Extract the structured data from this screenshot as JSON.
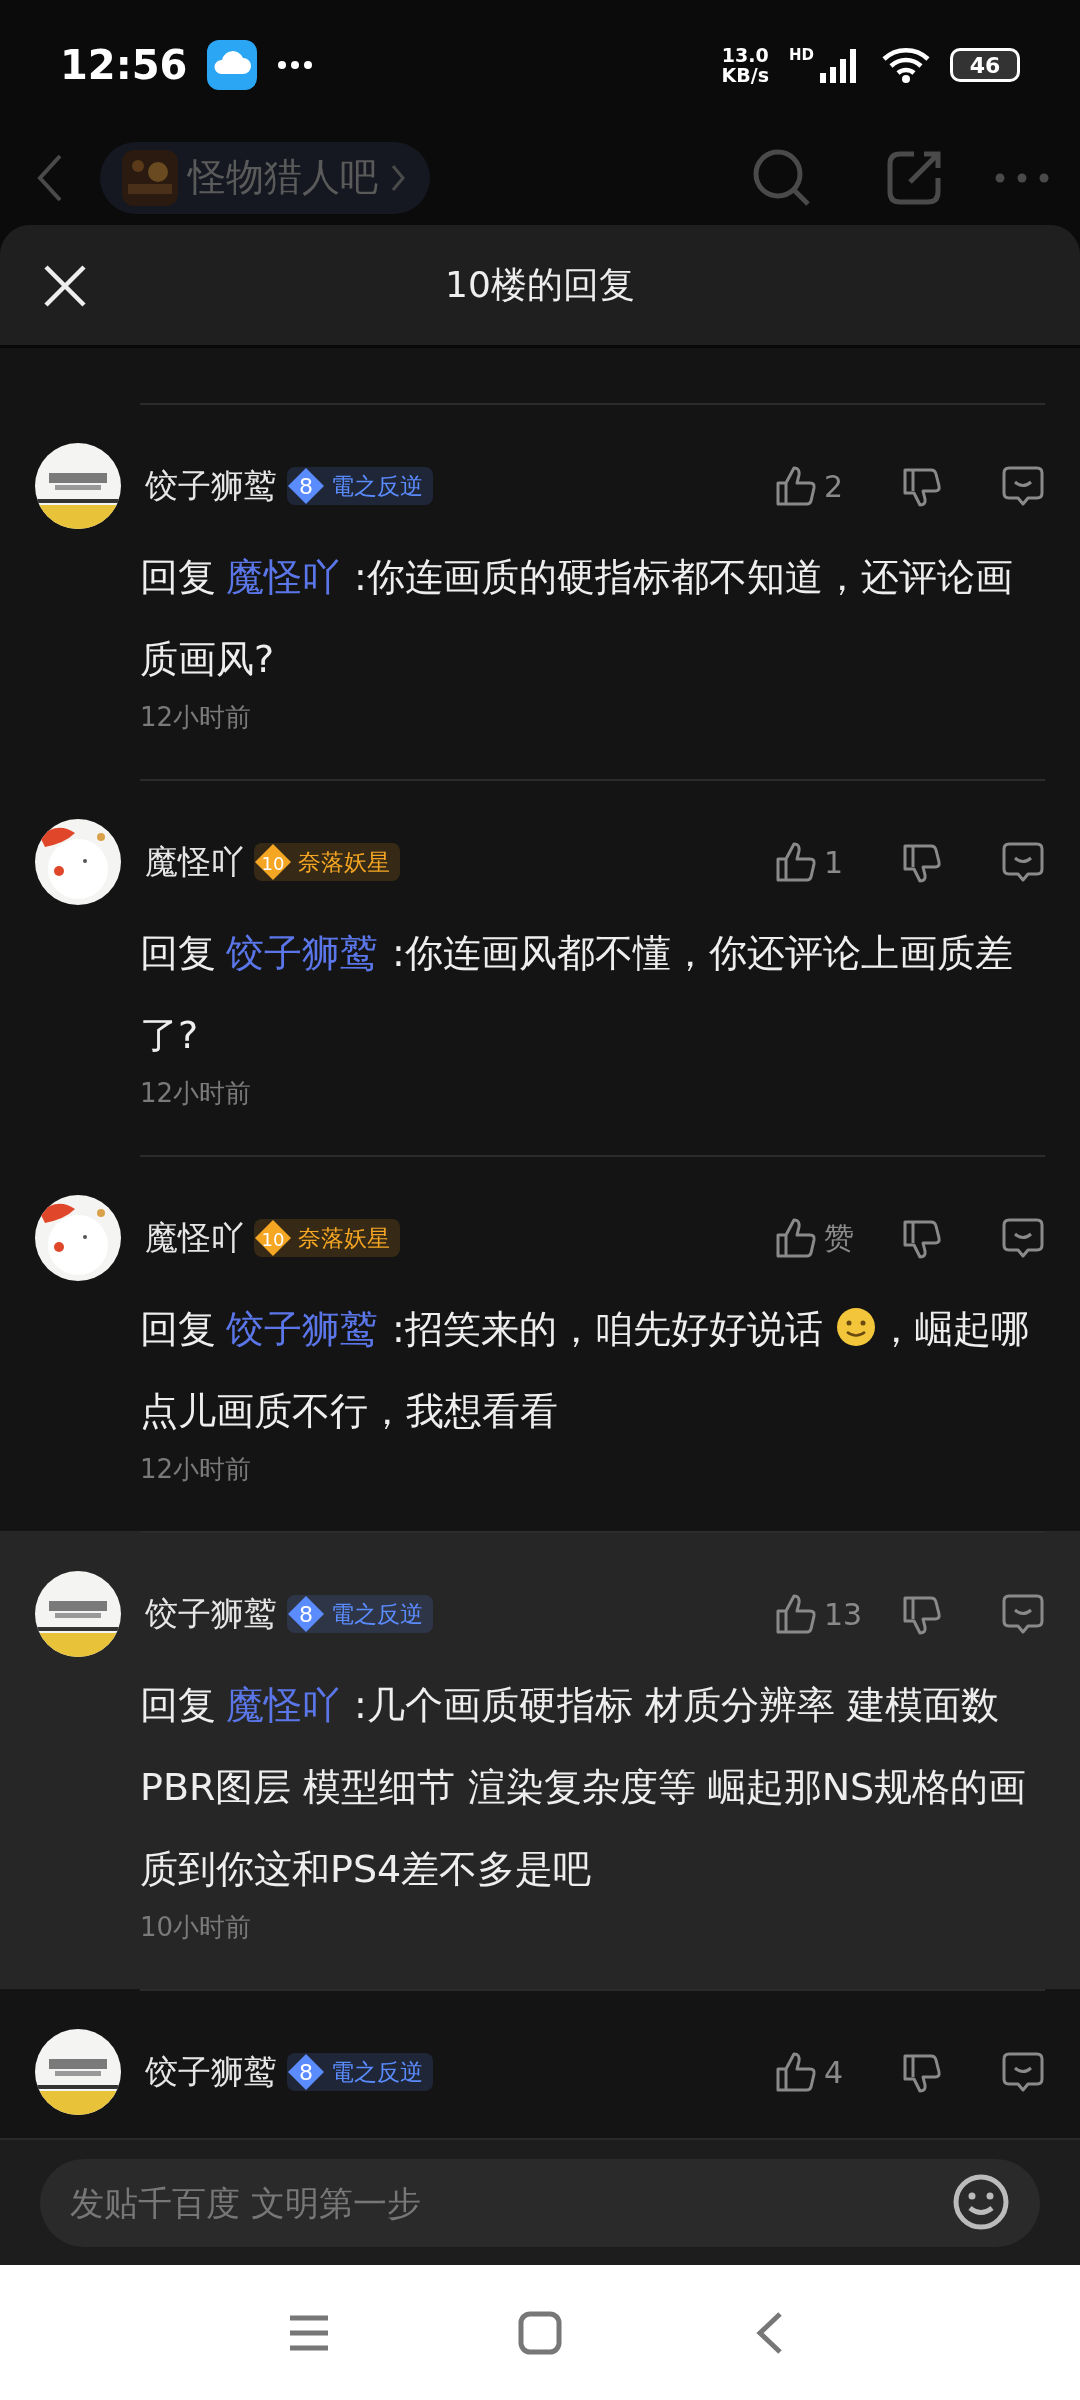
{
  "status_bar": {
    "time": "12:56",
    "net_speed": "13.0",
    "net_unit": "KB/s",
    "network_type": "HD",
    "battery": "46"
  },
  "forum_header": {
    "forum_name": "怪物猎人吧"
  },
  "sheet": {
    "title": "10楼的回复"
  },
  "comments": [
    {
      "user": "饺子狮鹫",
      "level": "8",
      "badge": {
        "title": "電之反逆",
        "color": "#5b8cff"
      },
      "likes": "2",
      "reply_prefix": "回复",
      "reply_to": "魔怪吖",
      "segments": [
        {
          "kind": "text",
          "text": ":你连画质的硬指标都不知道，还评论画质画风?"
        }
      ],
      "time": "12小时前",
      "highlighted": false
    },
    {
      "user": "魔怪吖",
      "level": "10",
      "badge": {
        "title": "奈落妖星",
        "color": "#f5a623"
      },
      "likes": "1",
      "reply_prefix": "回复",
      "reply_to": "饺子狮鹫",
      "segments": [
        {
          "kind": "text",
          "text": ":你连画风都不懂，你还评论上画质差了?"
        }
      ],
      "time": "12小时前",
      "highlighted": false
    },
    {
      "user": "魔怪吖",
      "level": "10",
      "badge": {
        "title": "奈落妖星",
        "color": "#f5a623"
      },
      "likes": "赞",
      "reply_prefix": "回复",
      "reply_to": "饺子狮鹫",
      "segments": [
        {
          "kind": "text",
          "text": ":招笑来的，咱先好好说话 "
        },
        {
          "kind": "emoji"
        },
        {
          "kind": "text",
          "text": "，崛起哪点儿画质不行，我想看看"
        }
      ],
      "time": "12小时前",
      "highlighted": false
    },
    {
      "user": "饺子狮鹫",
      "level": "8",
      "badge": {
        "title": "電之反逆",
        "color": "#5b8cff"
      },
      "likes": "13",
      "reply_prefix": "回复",
      "reply_to": "魔怪吖",
      "segments": [
        {
          "kind": "text",
          "text": ":几个画质硬指标 材质分辨率 建模面数 PBR图层 模型细节 渲染复杂度等 崛起那NS规格的画质到你这和PS4差不多是吧"
        }
      ],
      "time": "10小时前",
      "highlighted": true
    },
    {
      "user": "饺子狮鹫",
      "level": "8",
      "badge": {
        "title": "電之反逆",
        "color": "#5b8cff"
      },
      "likes": "4",
      "highlighted": false
    }
  ],
  "composer": {
    "placeholder": "发贴千百度 文明第一步"
  }
}
